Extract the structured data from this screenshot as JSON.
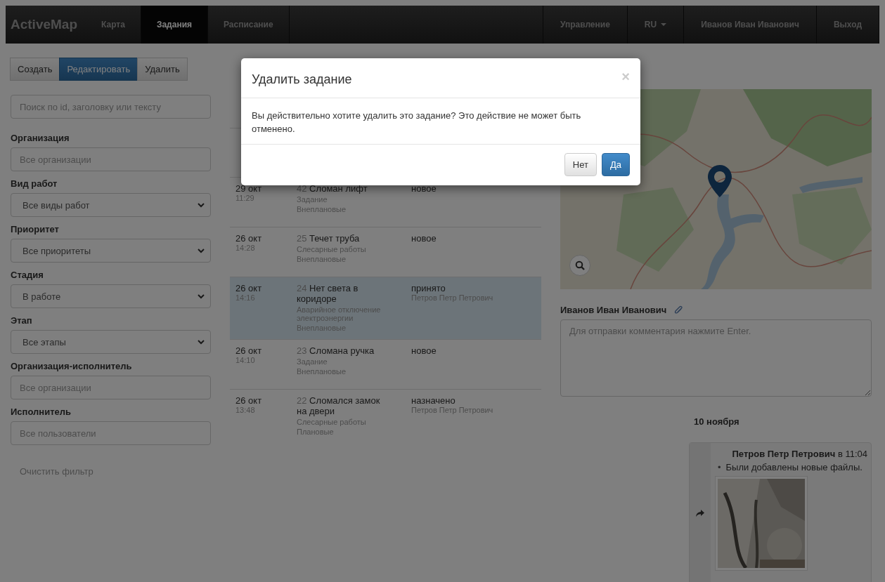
{
  "navbar": {
    "brand": "ActiveMap",
    "items": [
      {
        "label": "Карта",
        "selected": false
      },
      {
        "label": "Задания",
        "selected": true
      },
      {
        "label": "Расписание",
        "selected": false
      }
    ],
    "right_items": [
      {
        "label": "Управление",
        "kind": "link"
      },
      {
        "label": "RU",
        "kind": "dropdown"
      },
      {
        "label": "Иванов Иван Иванович",
        "kind": "link"
      },
      {
        "label": "Выход",
        "kind": "link"
      }
    ]
  },
  "toolbar": [
    {
      "label": "Создать",
      "selected": false
    },
    {
      "label": "Редактировать",
      "selected": true
    },
    {
      "label": "Удалить",
      "selected": false
    }
  ],
  "search": {
    "placeholder": "Поиск по id, заголовку или тексту"
  },
  "filters": [
    {
      "label": "Организация",
      "kind": "input",
      "placeholder": "Все организации"
    },
    {
      "label": "Вид работ",
      "kind": "select",
      "value": "Все виды работ"
    },
    {
      "label": "Приоритет",
      "kind": "select",
      "value": "Все приоритеты"
    },
    {
      "label": "Стадия",
      "kind": "select",
      "value": "В работе"
    },
    {
      "label": "Этап",
      "kind": "select",
      "value": "Все этапы"
    },
    {
      "label": "Организация-исполнитель",
      "kind": "input",
      "placeholder": "Все организации"
    },
    {
      "label": "Исполнитель",
      "kind": "input",
      "placeholder": "Все пользователи"
    }
  ],
  "clear_filter": "Очистить фильтр",
  "tasks": [
    {
      "date": "29 окт",
      "time": "11:29",
      "number": "42",
      "title": "Сломан лифт",
      "details": [
        "Задание",
        "Внеплановые"
      ],
      "status": "новое",
      "selected": false
    },
    {
      "date": "26 окт",
      "time": "14:28",
      "number": "25",
      "title": "Течет труба",
      "details": [
        "Слесарные работы",
        "Внеплановые"
      ],
      "status": "новое",
      "selected": false
    },
    {
      "date": "26 окт",
      "time": "14:16",
      "number": "24",
      "title": "Нет света в коридоре",
      "details": [
        "Аварийное отключение электроэнергии",
        "Внеплановые"
      ],
      "status": "принято",
      "assignee": "Петров Петр Петрович",
      "selected": true
    },
    {
      "date": "26 окт",
      "time": "14:10",
      "number": "23",
      "title": "Сломана ручка",
      "details": [
        "Задание",
        "Внеплановые"
      ],
      "status": "новое",
      "selected": false
    },
    {
      "date": "26 окт",
      "time": "13:48",
      "number": "22",
      "title": "Сломался замок на двери",
      "details": [
        "Слесарные работы",
        "Плановые"
      ],
      "status": "назначено",
      "assignee": "Петров Петр Петрович",
      "selected": false
    }
  ],
  "map": {
    "kind": "picture"
  },
  "comment": {
    "author": "Иванов Иван Иванович",
    "placeholder": "Для отправки комментария нажмите Enter."
  },
  "history": {
    "date": "10 ноября",
    "entries": [
      {
        "author": "Петров Петр Петрович",
        "time": "в 11:04",
        "items": [
          {
            "bullet": "•",
            "text": "Были добавлены новые файлы."
          }
        ],
        "attachment": {
          "kind": "picture"
        }
      }
    ]
  },
  "modal": {
    "title": "Удалить задание",
    "close": "×",
    "message": "Вы действительно хотите удалить это задание? Это действие не может быть отменено.",
    "buttons": [
      {
        "label": "Нет",
        "kind": "default"
      },
      {
        "label": "Да",
        "kind": "primary"
      }
    ]
  }
}
